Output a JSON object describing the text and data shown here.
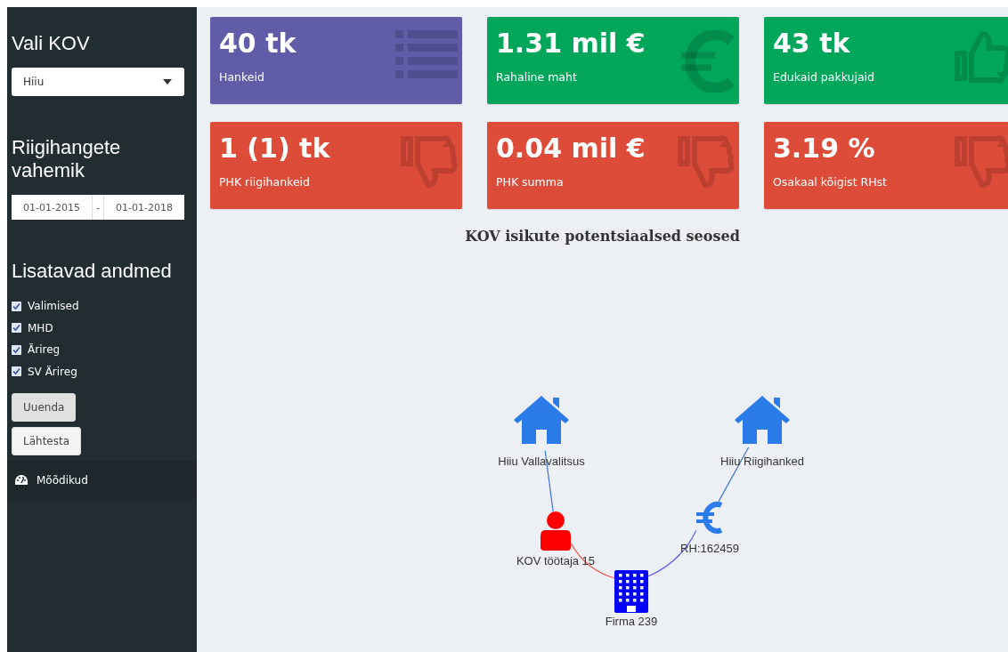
{
  "sidebar": {
    "kov_heading": "Vali KOV",
    "kov_select": {
      "value": "Hiiu"
    },
    "range_heading": "Riigihangete vahemik",
    "date_range": {
      "start": "01-01-2015",
      "separator": "-",
      "end": "01-01-2018"
    },
    "data_heading": "Lisatavad andmed",
    "checkboxes": [
      {
        "label": "Valimised",
        "checked": true
      },
      {
        "label": "MHD",
        "checked": true
      },
      {
        "label": "Ärireg",
        "checked": true
      },
      {
        "label": "SV Ärireg",
        "checked": true
      }
    ],
    "buttons": [
      {
        "label": "Uuenda",
        "pressed": true
      },
      {
        "label": "Lähtesta",
        "pressed": false
      }
    ],
    "menu": [
      {
        "label": "Mõõdikud"
      }
    ]
  },
  "value_boxes": [
    {
      "value": "40 tk",
      "label": "Hankeid",
      "color": "#605ca8",
      "kind": "list"
    },
    {
      "value": "1.31 mil €",
      "label": "Rahaline maht",
      "color": "#00a65a",
      "kind": "euro"
    },
    {
      "value": "43 tk",
      "label": "Edukaid pakkujaid",
      "color": "#00a65a",
      "kind": "thumbs-up"
    },
    {
      "value": "1 (1) tk",
      "label": "PHK riigihankeid",
      "color": "#dd4b39",
      "kind": "thumbs-down"
    },
    {
      "value": "0.04 mil €",
      "label": "PHK summa",
      "color": "#dd4b39",
      "kind": "thumbs-down"
    },
    {
      "value": "3.19 %",
      "label": "Osakaal kõigist RHst",
      "color": "#dd4b39",
      "kind": "thumbs-down"
    }
  ],
  "graph": {
    "title": "KOV isikute potentsiaalsed seosed",
    "nodes": [
      {
        "kind": "house",
        "label": "Hiiu Vallavalitsus",
        "color": "#2b7ce9"
      },
      {
        "kind": "house",
        "label": "Hiiu Riigihanked",
        "color": "#2b7ce9"
      },
      {
        "kind": "person",
        "label": "KOV töötaja 15",
        "color": "#ff0000"
      },
      {
        "kind": "euro",
        "label": "RH:162459",
        "color": "#2b7ce9"
      },
      {
        "kind": "building",
        "label": "Firma 239",
        "color": "#0000ff"
      }
    ],
    "edges": [
      {
        "color": "#3f74d6"
      },
      {
        "color": "#ff4a4a"
      },
      {
        "color": "#5a5aff"
      },
      {
        "color": "#3f74d6"
      }
    ]
  }
}
